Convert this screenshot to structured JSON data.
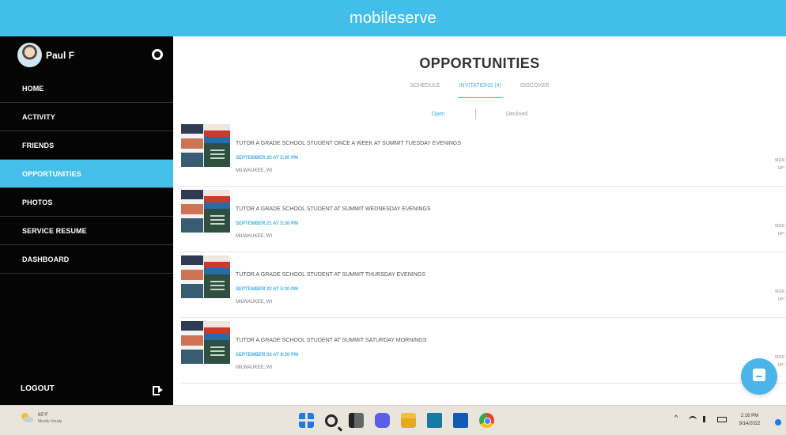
{
  "app": {
    "title": "mobileserve"
  },
  "sidebar": {
    "user_name": "Paul F",
    "items": [
      {
        "label": "HOME"
      },
      {
        "label": "ACTIVITY"
      },
      {
        "label": "FRIENDS"
      },
      {
        "label": "OPPORTUNITIES",
        "active": true
      },
      {
        "label": "PHOTOS"
      },
      {
        "label": "SERVICE RESUME"
      },
      {
        "label": "DASHBOARD"
      }
    ],
    "logout_label": "LOGOUT"
  },
  "main": {
    "title": "OPPORTUNITIES",
    "tabs": [
      {
        "label": "SCHEDULE"
      },
      {
        "label": "INVITATIONS (4)",
        "active": true
      },
      {
        "label": "DISCOVER"
      }
    ],
    "filters": [
      {
        "label": "Open",
        "active": true
      },
      {
        "label": "Declined"
      }
    ],
    "opportunities": [
      {
        "title": "TUTOR A GRADE SCHOOL STUDENT ONCE A WEEK AT SUMMIT TUESDAY EVENINGS",
        "date": "SEPTEMBER 20 AT 5:30 PM",
        "location": "MILWAUKEE, WI",
        "side_text": "SIGN UP!"
      },
      {
        "title": "TUTOR A GRADE SCHOOL STUDENT AT SUMMIT WEDNESDAY EVENINGS",
        "date": "SEPTEMBER 21 AT 5:30 PM",
        "location": "MILWAUKEE, WI",
        "side_text": "SIGN UP!"
      },
      {
        "title": "TUTOR A GRADE SCHOOL STUDENT AT SUMMIT THURSDAY EVENINGS",
        "date": "SEPTEMBER 22 AT 5:30 PM",
        "location": "MILWAUKEE, WI",
        "side_text": "SIGN UP!"
      },
      {
        "title": "TUTOR A GRADE SCHOOL STUDENT AT SUMMIT SATURDAY MORNINGS",
        "date": "SEPTEMBER 24 AT 9:30 PM",
        "location": "MILWAUKEE, WI",
        "side_text": "SIGN UP!"
      }
    ]
  },
  "taskbar": {
    "weather_temp": "65°F",
    "weather_desc": "Mostly cloudy",
    "time": "2:16 PM",
    "date": "9/14/2022",
    "icons": [
      "start-icon",
      "search-icon",
      "task-view-icon",
      "chat-icon",
      "file-explorer-icon",
      "store-icon",
      "mail-icon",
      "chrome-icon"
    ]
  },
  "colors": {
    "accent": "#44bfea",
    "sidebar": "#050505",
    "active_text": "#42b2e6"
  }
}
